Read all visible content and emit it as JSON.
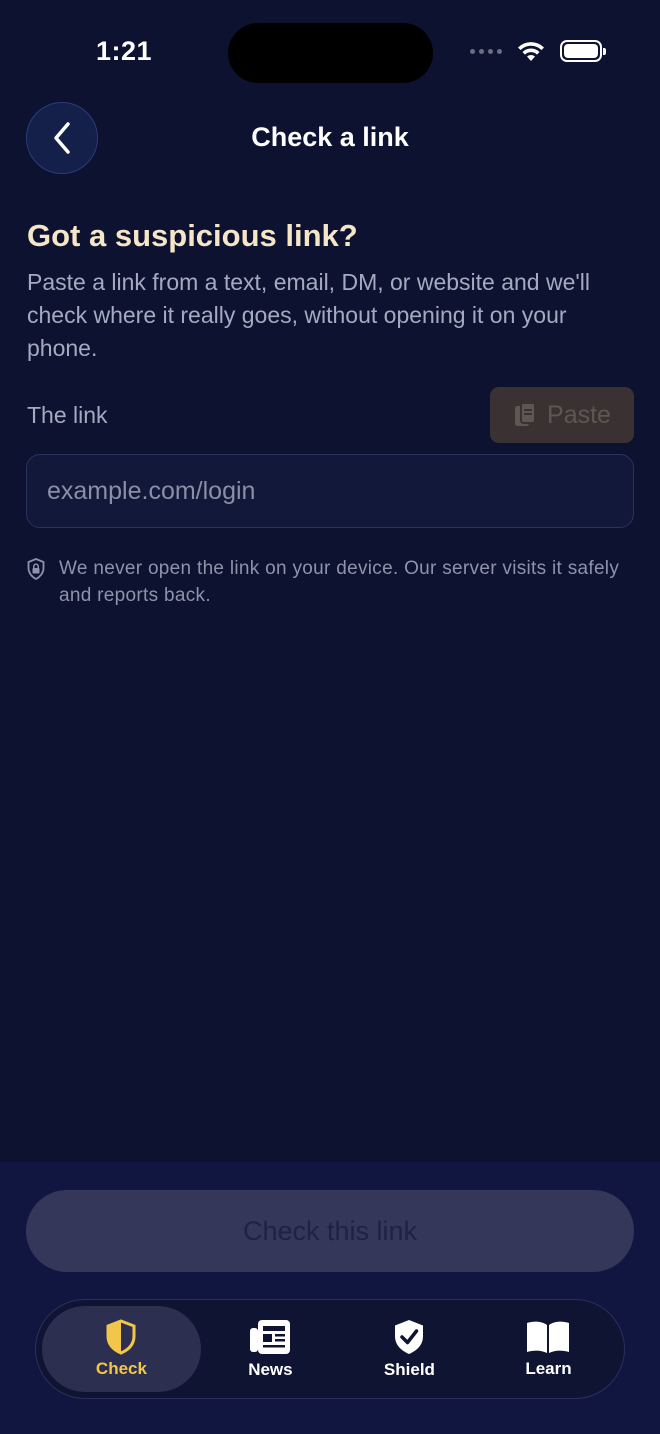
{
  "status_bar": {
    "time": "1:21"
  },
  "header": {
    "title": "Check a link"
  },
  "main": {
    "headline": "Got a suspicious link?",
    "description": "Paste a link from a text, email, DM, or website and we'll check where it really goes, without opening it on your phone.",
    "field_label": "The link",
    "paste_label": "Paste",
    "input": {
      "value": "",
      "placeholder": "example.com/login"
    },
    "privacy_note": "We never open the link on your device. Our server visits it safely and reports back."
  },
  "actions": {
    "check_label": "Check this link"
  },
  "tabs": [
    {
      "label": "Check",
      "icon": "shield-half-icon",
      "active": true
    },
    {
      "label": "News",
      "icon": "newspaper-icon",
      "active": false
    },
    {
      "label": "Shield",
      "icon": "shield-check-icon",
      "active": false
    },
    {
      "label": "Learn",
      "icon": "book-icon",
      "active": false
    }
  ],
  "colors": {
    "background": "#0d1230",
    "accent": "#f2c64b",
    "headline": "#f5e6c8",
    "muted_text": "#a5aac0"
  }
}
